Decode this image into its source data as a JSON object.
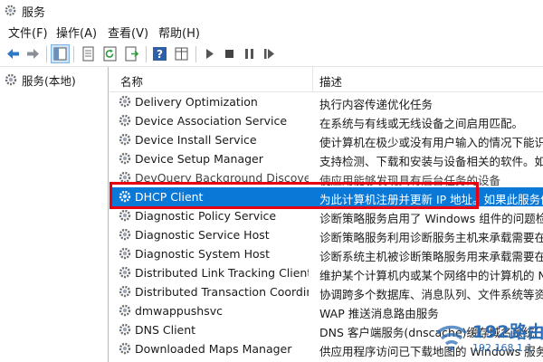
{
  "window": {
    "title": "服务"
  },
  "menu": [
    "文件(F)",
    "操作(A)",
    "查看(V)",
    "帮助(H)"
  ],
  "toolbar": {
    "buttons": [
      "back-arrow-icon",
      "forward-arrow-icon",
      "console-tree-icon",
      "properties-icon",
      "refresh-icon",
      "export-icon",
      "help-icon",
      "view-icon",
      "play-icon",
      "stop-icon",
      "pause-icon",
      "restart-icon"
    ]
  },
  "tree": {
    "root_label": "服务(本地)"
  },
  "columns": {
    "name": "名称",
    "description": "描述",
    "sort_indicator": "^"
  },
  "services": [
    {
      "name": "Delivery Optimization",
      "description": "执行内容传递优化任务"
    },
    {
      "name": "Device Association Service",
      "description": "在系统与有线或无线设备之间启用匹配。"
    },
    {
      "name": "Device Install Service",
      "description": "使计算机在极少或没有用户输入的情况下能识别"
    },
    {
      "name": "Device Setup Manager",
      "description": "支持检测、下载和安装与设备相关的软件。如果"
    },
    {
      "name": "DevQuery Background Discover",
      "description": "使应用能够发现具有后台任务的设备"
    },
    {
      "name": "DHCP Client",
      "description": "为此计算机注册并更新 IP 地址。如果此服务停"
    },
    {
      "name": "Diagnostic Policy Service",
      "description": "诊断策略服务启用了 Windows 组件的问题检"
    },
    {
      "name": "Diagnostic Service Host",
      "description": "诊断策略服务利用诊断服务主机来承载需要在本"
    },
    {
      "name": "Diagnostic System Host",
      "description": "诊断系统主机被诊断策略服务用来承载需要在本"
    },
    {
      "name": "Distributed Link Tracking Client",
      "description": "维护某个计算机内或某个网络中的计算机的 NT"
    },
    {
      "name": "Distributed Transaction Coordin...",
      "description": "协调跨多个数据库、消息队列、文件系统等资源"
    },
    {
      "name": "dmwappushsvc",
      "description": "WAP 推送消息路由服务"
    },
    {
      "name": "DNS Client",
      "description": "DNS 客户端服务(dnscache)缓存域名系统("
    },
    {
      "name": "Downloaded Maps Manager",
      "description": "供应用程序访问已下载地图的 Windows 服务。"
    }
  ],
  "selected_service": "DHCP Client",
  "watermark": {
    "brand": "192路由网",
    "site": "192.168.1.1"
  },
  "colors": {
    "selection": "#0a78d7",
    "highlight_border": "#e60012",
    "watermark": "#2d6db5"
  }
}
